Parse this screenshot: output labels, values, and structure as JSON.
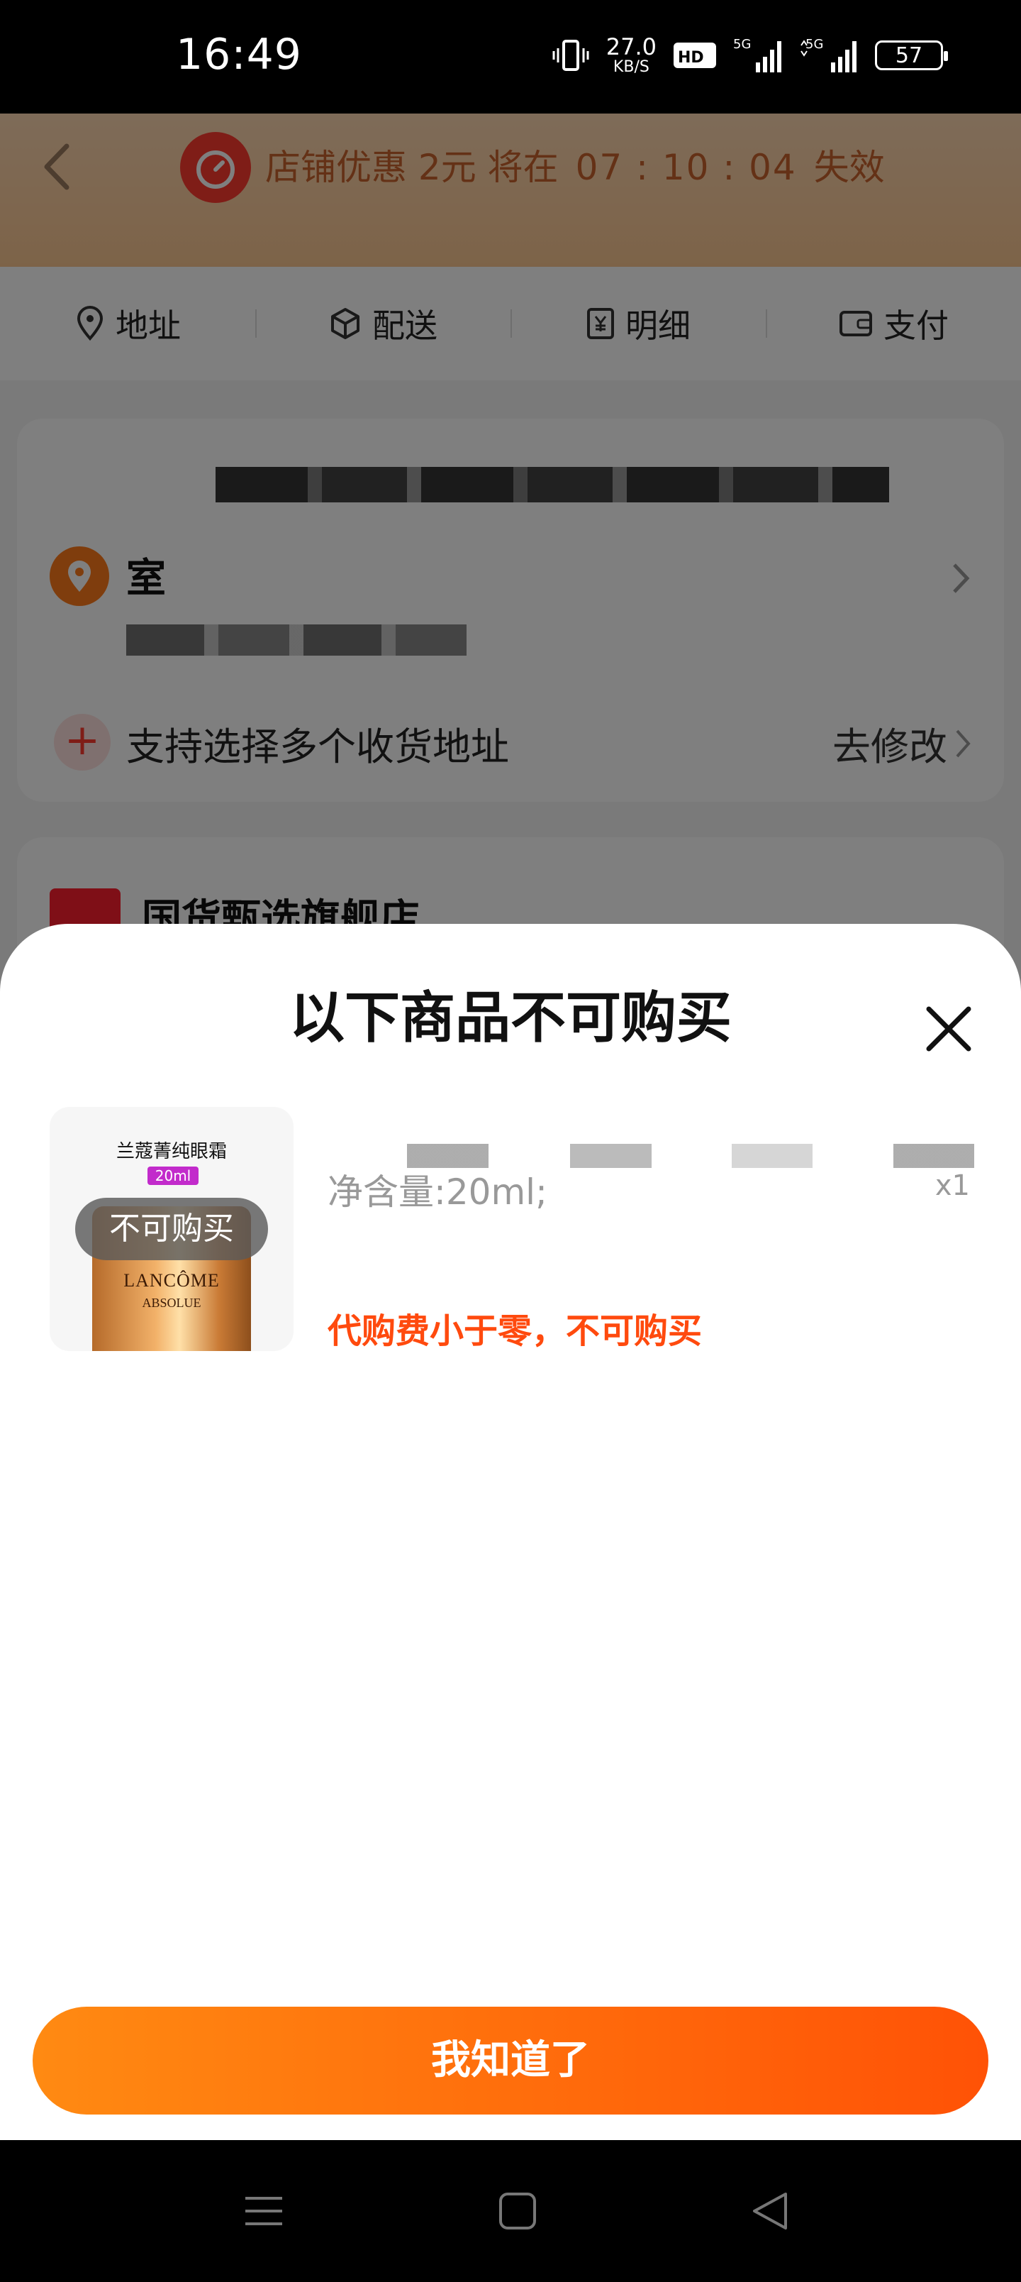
{
  "status_bar": {
    "time": "16:49",
    "net_speed": "27.0",
    "net_speed_unit": "KB/S",
    "battery": "57",
    "network_1": "5G",
    "network_2": "5G"
  },
  "promo": {
    "prefix": "店铺优惠 2元 将在",
    "countdown": "07 : 10 : 04",
    "suffix": "失效"
  },
  "steps": [
    {
      "icon": "location-pin-icon",
      "label": "地址"
    },
    {
      "icon": "box-icon",
      "label": "配送"
    },
    {
      "icon": "yuan-receipt-icon",
      "label": "明细"
    },
    {
      "icon": "wallet-icon",
      "label": "支付"
    }
  ],
  "address": {
    "room": "室",
    "multi_label": "支持选择多个收货地址",
    "modify_label": "去修改"
  },
  "store": {
    "name": "国货甄选旗舰店"
  },
  "sheet": {
    "title": "以下商品不可购买",
    "product": {
      "image_caption": "兰蔻菁纯眼霜",
      "image_size_tag": "20ml",
      "image_brand": "LANCÔME",
      "image_sub": "ABSOLUE",
      "unavailable_badge": "不可购买",
      "spec": "净含量:20ml;",
      "quantity": "x1",
      "reason": "代购费小于零，不可购买"
    },
    "confirm_label": "我知道了"
  },
  "colors": {
    "accent_orange": "#ff5206",
    "reason_red": "#ff4a0e",
    "promo_bg": "#fbc791"
  }
}
